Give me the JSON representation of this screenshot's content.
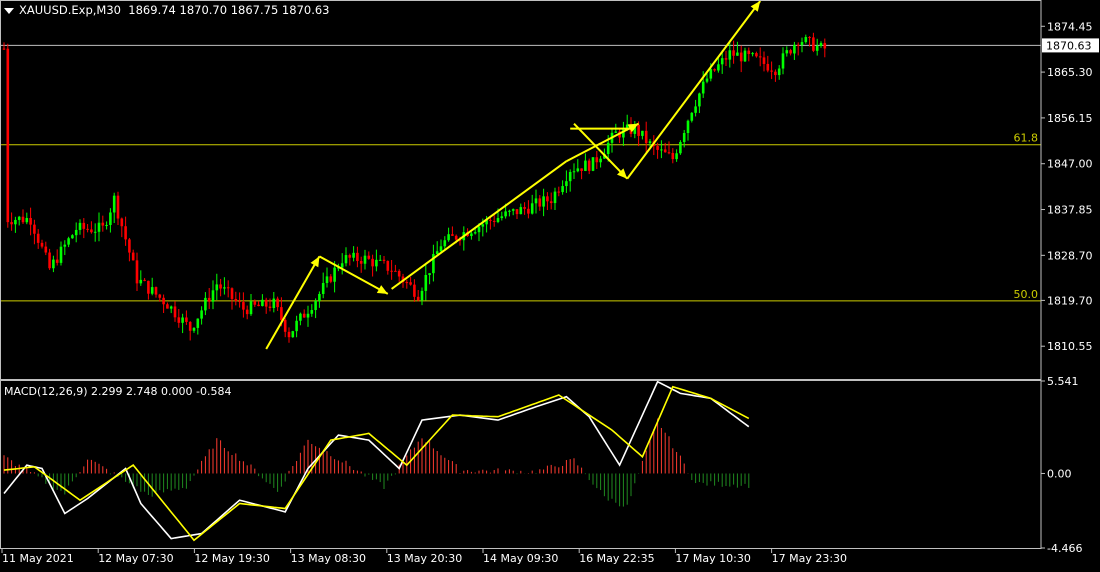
{
  "header": {
    "symbol": "XAUUSD.Exp,M30",
    "ohlc": "1869.74 1870.70 1867.75 1870.63"
  },
  "macd_header": "MACD(12,26,9) 2.299 2.748 0.000 -0.584",
  "colors": {
    "background": "#000000",
    "bull": "#00ff00",
    "bear": "#ff0000",
    "arrow": "#ffff00",
    "fib_line": "#cccc00",
    "price_line": "#bfbfbf",
    "macd_line": "#ffffff",
    "signal_line": "#ffff00",
    "hist_pos": "#ff3b30",
    "hist_neg": "#1f8a1f"
  },
  "chart_data": [
    {
      "type": "candlestick",
      "title": "XAUUSD.Exp,M30",
      "ylim": [
        1804,
        1879.5
      ],
      "price_ticks": [
        "1874.45",
        "1865.30",
        "1856.15",
        "1847.00",
        "1837.85",
        "1828.70",
        "1819.70",
        "1810.55"
      ],
      "current_price": "1870.63",
      "x_tick_labels": [
        "11 May 2021",
        "12 May 07:30",
        "12 May 19:30",
        "13 May 08:30",
        "13 May 20:30",
        "14 May 09:30",
        "16 May 22:35",
        "17 May 10:30",
        "17 May 23:30"
      ],
      "fib_levels": [
        {
          "label": "61.8",
          "price": 1850.8
        },
        {
          "label": "50.0",
          "price": 1819.6
        }
      ],
      "path_anchors": [
        {
          "bar": 2,
          "price": 1836
        },
        {
          "bar": 8,
          "price": 1836
        },
        {
          "bar": 13,
          "price": 1826
        },
        {
          "bar": 20,
          "price": 1834
        },
        {
          "bar": 27,
          "price": 1834
        },
        {
          "bar": 30,
          "price": 1840
        },
        {
          "bar": 36,
          "price": 1824
        },
        {
          "bar": 44,
          "price": 1819
        },
        {
          "bar": 50,
          "price": 1814
        },
        {
          "bar": 57,
          "price": 1823
        },
        {
          "bar": 64,
          "price": 1818
        },
        {
          "bar": 72,
          "price": 1819
        },
        {
          "bar": 76,
          "price": 1813
        },
        {
          "bar": 84,
          "price": 1821
        },
        {
          "bar": 90,
          "price": 1828
        },
        {
          "bar": 96,
          "price": 1828
        },
        {
          "bar": 103,
          "price": 1826
        },
        {
          "bar": 110,
          "price": 1821
        },
        {
          "bar": 116,
          "price": 1831
        },
        {
          "bar": 124,
          "price": 1834
        },
        {
          "bar": 130,
          "price": 1836
        },
        {
          "bar": 138,
          "price": 1838
        },
        {
          "bar": 145,
          "price": 1840
        },
        {
          "bar": 150,
          "price": 1846
        },
        {
          "bar": 156,
          "price": 1847
        },
        {
          "bar": 162,
          "price": 1853
        },
        {
          "bar": 167,
          "price": 1854
        },
        {
          "bar": 172,
          "price": 1850
        },
        {
          "bar": 177,
          "price": 1848
        },
        {
          "bar": 182,
          "price": 1858
        },
        {
          "bar": 186,
          "price": 1864
        },
        {
          "bar": 192,
          "price": 1869
        },
        {
          "bar": 198,
          "price": 1868
        },
        {
          "bar": 204,
          "price": 1866
        },
        {
          "bar": 210,
          "price": 1872
        },
        {
          "bar": 216,
          "price": 1870
        }
      ],
      "trend_arrows": [
        {
          "from": {
            "bar": 69,
            "price": 1810
          },
          "to": {
            "bar": 83,
            "price": 1828.5
          },
          "head": true
        },
        {
          "from": {
            "bar": 83,
            "price": 1828.5
          },
          "to": {
            "bar": 101,
            "price": 1821
          },
          "head": true
        },
        {
          "from": {
            "bar": 102,
            "price": 1822
          },
          "to": {
            "bar": 148,
            "price": 1847.5
          },
          "head": false
        },
        {
          "from": {
            "bar": 148,
            "price": 1847.5
          },
          "to": {
            "bar": 167,
            "price": 1855
          },
          "head": true
        },
        {
          "from": {
            "bar": 149,
            "price": 1854
          },
          "to": {
            "bar": 165,
            "price": 1854
          },
          "head": false
        },
        {
          "from": {
            "bar": 150,
            "price": 1855
          },
          "to": {
            "bar": 164,
            "price": 1844
          },
          "head": true
        },
        {
          "from": {
            "bar": 164,
            "price": 1844
          },
          "to": {
            "bar": 199,
            "price": 1879.5
          },
          "head": true
        }
      ]
    },
    {
      "type": "line",
      "title": "MACD(12,26,9)",
      "ylim": [
        -4.466,
        5.541
      ],
      "y_ticks": [
        "5.541",
        "0.00",
        "-4.466"
      ],
      "series": [
        {
          "name": "MACD",
          "anchors": [
            {
              "bar": 0,
              "value": -1.2
            },
            {
              "bar": 6,
              "value": 0.5
            },
            {
              "bar": 10,
              "value": 0.3
            },
            {
              "bar": 16,
              "value": -2.4
            },
            {
              "bar": 22,
              "value": -1.5
            },
            {
              "bar": 32,
              "value": 0.3
            },
            {
              "bar": 36,
              "value": -1.8
            },
            {
              "bar": 44,
              "value": -3.9
            },
            {
              "bar": 52,
              "value": -3.6
            },
            {
              "bar": 62,
              "value": -1.6
            },
            {
              "bar": 74,
              "value": -2.3
            },
            {
              "bar": 80,
              "value": 0.3
            },
            {
              "bar": 88,
              "value": 2.3
            },
            {
              "bar": 96,
              "value": 2.0
            },
            {
              "bar": 104,
              "value": 0.3
            },
            {
              "bar": 110,
              "value": 3.2
            },
            {
              "bar": 120,
              "value": 3.5
            },
            {
              "bar": 130,
              "value": 3.2
            },
            {
              "bar": 140,
              "value": 4.0
            },
            {
              "bar": 148,
              "value": 4.6
            },
            {
              "bar": 154,
              "value": 3.4
            },
            {
              "bar": 162,
              "value": 0.5
            },
            {
              "bar": 172,
              "value": 5.5
            },
            {
              "bar": 178,
              "value": 4.8
            },
            {
              "bar": 186,
              "value": 4.5
            },
            {
              "bar": 196,
              "value": 2.8
            }
          ]
        },
        {
          "name": "Signal",
          "anchors": [
            {
              "bar": 0,
              "value": 0.2
            },
            {
              "bar": 8,
              "value": 0.4
            },
            {
              "bar": 20,
              "value": -1.6
            },
            {
              "bar": 34,
              "value": 0.5
            },
            {
              "bar": 50,
              "value": -4.0
            },
            {
              "bar": 62,
              "value": -1.8
            },
            {
              "bar": 74,
              "value": -2.1
            },
            {
              "bar": 86,
              "value": 2.0
            },
            {
              "bar": 96,
              "value": 2.4
            },
            {
              "bar": 106,
              "value": 0.5
            },
            {
              "bar": 118,
              "value": 3.5
            },
            {
              "bar": 130,
              "value": 3.4
            },
            {
              "bar": 146,
              "value": 4.7
            },
            {
              "bar": 160,
              "value": 2.6
            },
            {
              "bar": 168,
              "value": 1.0
            },
            {
              "bar": 176,
              "value": 5.2
            },
            {
              "bar": 186,
              "value": 4.5
            },
            {
              "bar": 196,
              "value": 3.3
            }
          ]
        }
      ],
      "histogram_anchors": [
        {
          "bar": 0,
          "value": 1.0
        },
        {
          "bar": 8,
          "value": -0.1
        },
        {
          "bar": 16,
          "value": -1.2
        },
        {
          "bar": 22,
          "value": 0.9
        },
        {
          "bar": 30,
          "value": -0.2
        },
        {
          "bar": 38,
          "value": -1.3
        },
        {
          "bar": 48,
          "value": -0.8
        },
        {
          "bar": 56,
          "value": 2.0
        },
        {
          "bar": 66,
          "value": 0.2
        },
        {
          "bar": 72,
          "value": -1.1
        },
        {
          "bar": 80,
          "value": 2.0
        },
        {
          "bar": 90,
          "value": 0.6
        },
        {
          "bar": 100,
          "value": -0.8
        },
        {
          "bar": 110,
          "value": 2.2
        },
        {
          "bar": 120,
          "value": 0.2
        },
        {
          "bar": 140,
          "value": 0.1
        },
        {
          "bar": 150,
          "value": 0.8
        },
        {
          "bar": 158,
          "value": -1.4
        },
        {
          "bar": 164,
          "value": -2.0
        },
        {
          "bar": 172,
          "value": 3.2
        },
        {
          "bar": 182,
          "value": -0.6
        },
        {
          "bar": 196,
          "value": -0.7
        }
      ]
    }
  ]
}
